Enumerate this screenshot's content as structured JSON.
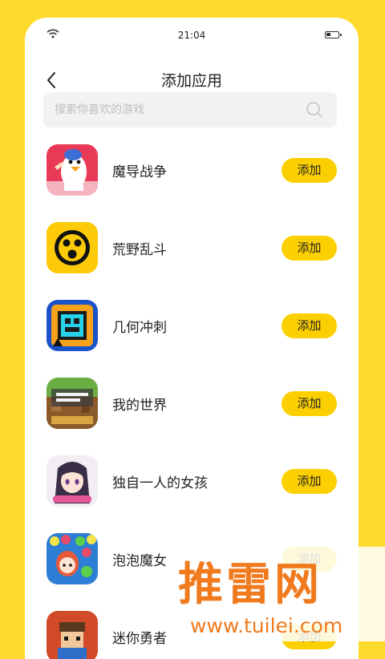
{
  "status_bar": {
    "time": "21:04",
    "wifi_icon": "wifi-icon",
    "battery_icon": "battery-icon"
  },
  "header": {
    "title": "添加应用",
    "back_icon": "chevron-left-icon"
  },
  "search": {
    "placeholder": "搜索你喜欢的游戏",
    "value": "",
    "icon": "search-icon"
  },
  "apps": [
    {
      "name": "魔导战争",
      "button": "添加",
      "icon": "goose-game-icon"
    },
    {
      "name": "荒野乱斗",
      "button": "添加",
      "icon": "brawl-stars-icon"
    },
    {
      "name": "几何冲刺",
      "button": "添加",
      "icon": "geometry-dash-icon"
    },
    {
      "name": "我的世界",
      "button": "添加",
      "icon": "minecraft-icon"
    },
    {
      "name": "独自一人的女孩",
      "button": "添加",
      "icon": "anime-girl-icon"
    },
    {
      "name": "泡泡魔女",
      "button": "添加",
      "icon": "bubble-witch-icon"
    },
    {
      "name": "迷你勇者",
      "button": "添加",
      "icon": "pixel-hero-icon"
    }
  ],
  "watermark": {
    "logo_text": "推雷网",
    "url": "www.tuilei.com"
  },
  "colors": {
    "background": "#FDDA2C",
    "accent": "#FCD000",
    "watermark": "#F07A1E"
  }
}
